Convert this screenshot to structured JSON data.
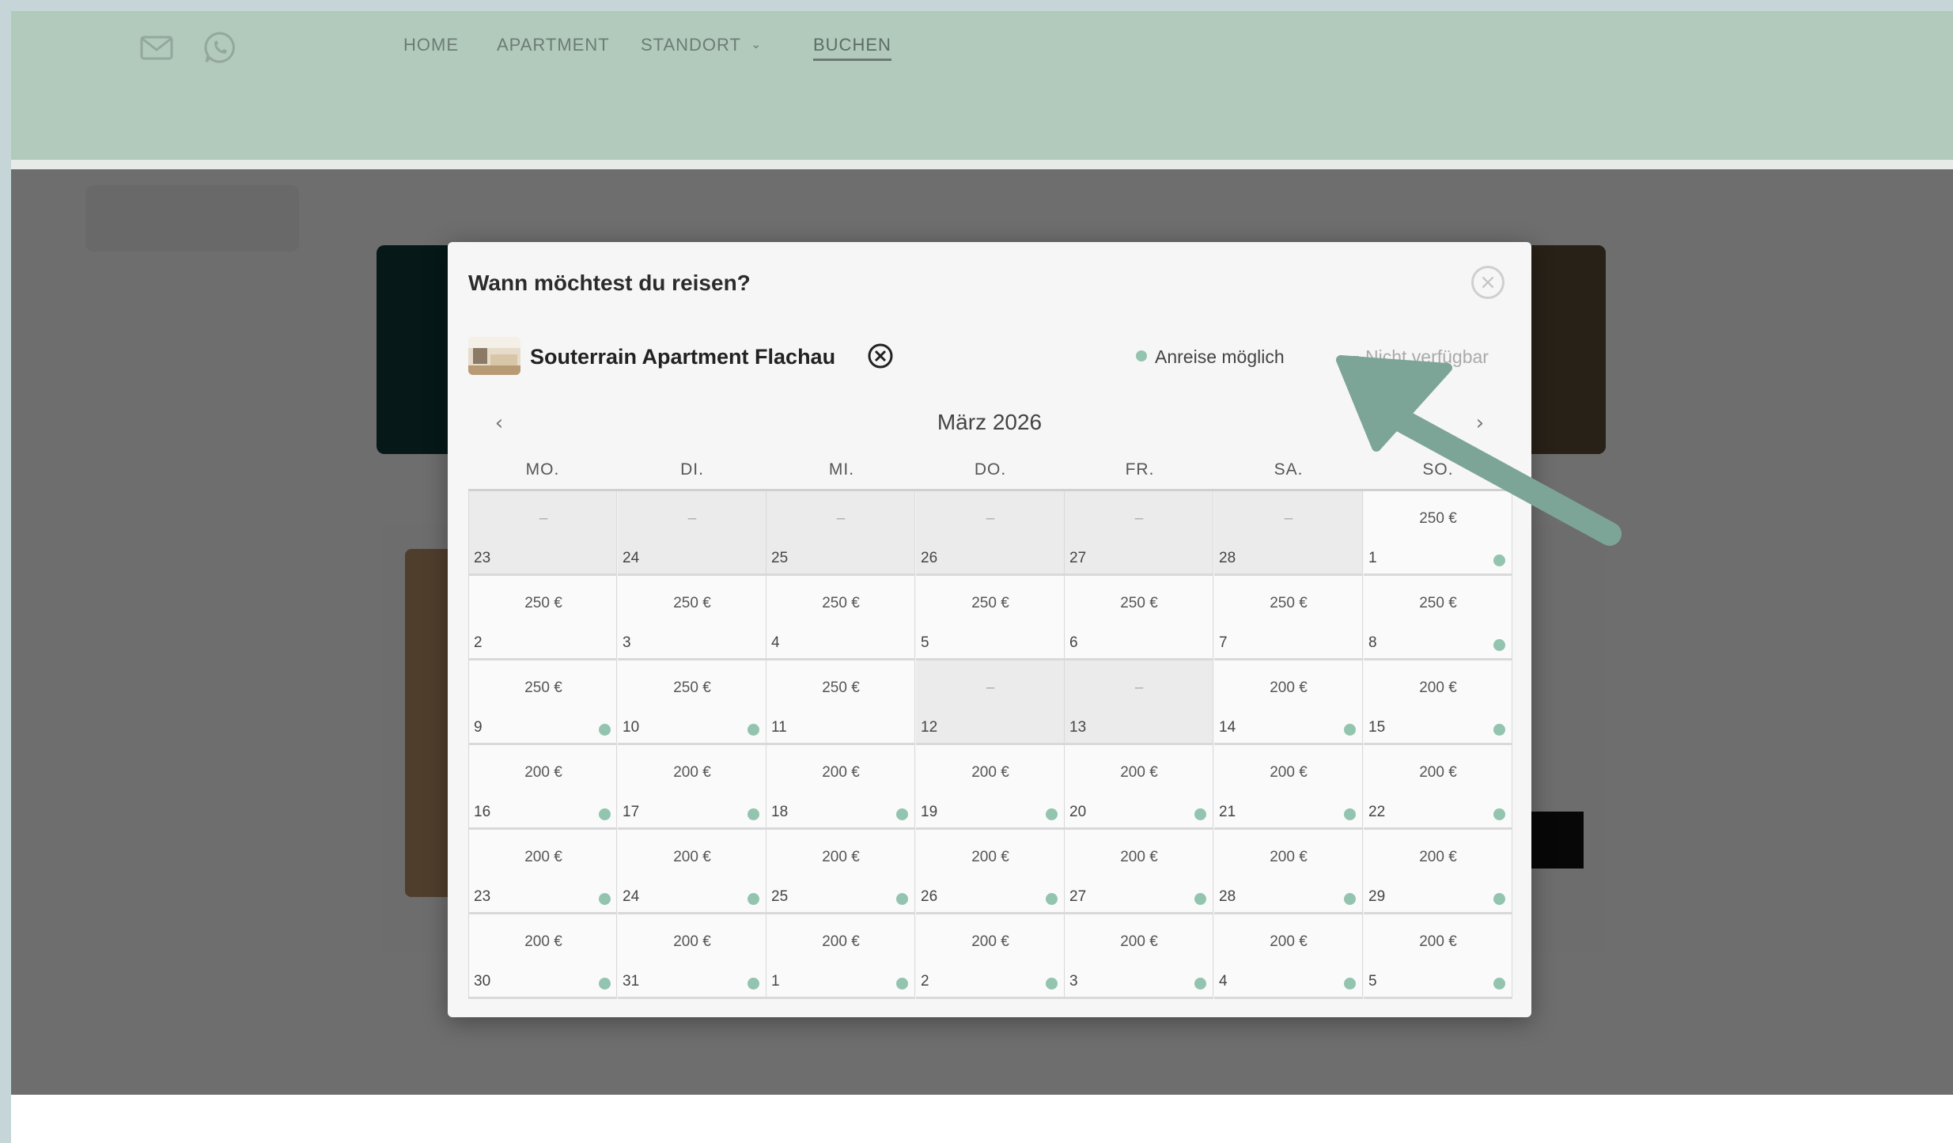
{
  "nav": {
    "items": [
      "HOME",
      "APARTMENT",
      "STANDORT",
      "BUCHEN"
    ],
    "active": "BUCHEN"
  },
  "icons": {
    "mail": "mail-icon",
    "whatsapp": "whatsapp-icon",
    "close": "close-icon",
    "remove": "remove-circle-icon"
  },
  "colors": {
    "header": "#b1cabb",
    "available_dot": "#93c4af",
    "arrow": "#7da597"
  },
  "modal": {
    "title": "Wann möchtest du reisen?",
    "close_symbol": "×",
    "apartment_name": "Souterrain Apartment Flachau",
    "legend_available": "Anreise möglich",
    "legend_unavailable": "Nicht verfügbar",
    "prev_symbol": "‹",
    "next_symbol": "›",
    "month_label": "März 2026"
  },
  "calendar": {
    "weekdays": [
      "MO.",
      "DI.",
      "MI.",
      "DO.",
      "FR.",
      "SA.",
      "SO."
    ],
    "days": [
      {
        "day": "23",
        "price": "–",
        "available": false
      },
      {
        "day": "24",
        "price": "–",
        "available": false
      },
      {
        "day": "25",
        "price": "–",
        "available": false
      },
      {
        "day": "26",
        "price": "–",
        "available": false
      },
      {
        "day": "27",
        "price": "–",
        "available": false
      },
      {
        "day": "28",
        "price": "–",
        "available": false
      },
      {
        "day": "1",
        "price": "250 €",
        "available": true
      },
      {
        "day": "2",
        "price": "250 €",
        "available": false
      },
      {
        "day": "3",
        "price": "250 €",
        "available": false
      },
      {
        "day": "4",
        "price": "250 €",
        "available": false
      },
      {
        "day": "5",
        "price": "250 €",
        "available": false
      },
      {
        "day": "6",
        "price": "250 €",
        "available": false
      },
      {
        "day": "7",
        "price": "250 €",
        "available": false
      },
      {
        "day": "8",
        "price": "250 €",
        "available": true
      },
      {
        "day": "9",
        "price": "250 €",
        "available": true
      },
      {
        "day": "10",
        "price": "250 €",
        "available": true
      },
      {
        "day": "11",
        "price": "250 €",
        "available": false
      },
      {
        "day": "12",
        "price": "–",
        "available": false
      },
      {
        "day": "13",
        "price": "–",
        "available": false
      },
      {
        "day": "14",
        "price": "200 €",
        "available": true
      },
      {
        "day": "15",
        "price": "200 €",
        "available": true
      },
      {
        "day": "16",
        "price": "200 €",
        "available": true
      },
      {
        "day": "17",
        "price": "200 €",
        "available": true
      },
      {
        "day": "18",
        "price": "200 €",
        "available": true
      },
      {
        "day": "19",
        "price": "200 €",
        "available": true
      },
      {
        "day": "20",
        "price": "200 €",
        "available": true
      },
      {
        "day": "21",
        "price": "200 €",
        "available": true
      },
      {
        "day": "22",
        "price": "200 €",
        "available": true
      },
      {
        "day": "23",
        "price": "200 €",
        "available": true
      },
      {
        "day": "24",
        "price": "200 €",
        "available": true
      },
      {
        "day": "25",
        "price": "200 €",
        "available": true
      },
      {
        "day": "26",
        "price": "200 €",
        "available": true
      },
      {
        "day": "27",
        "price": "200 €",
        "available": true
      },
      {
        "day": "28",
        "price": "200 €",
        "available": true
      },
      {
        "day": "29",
        "price": "200 €",
        "available": true
      },
      {
        "day": "30",
        "price": "200 €",
        "available": true
      },
      {
        "day": "31",
        "price": "200 €",
        "available": true
      },
      {
        "day": "1",
        "price": "200 €",
        "available": true
      },
      {
        "day": "2",
        "price": "200 €",
        "available": true
      },
      {
        "day": "3",
        "price": "200 €",
        "available": true
      },
      {
        "day": "4",
        "price": "200 €",
        "available": true
      },
      {
        "day": "5",
        "price": "200 €",
        "available": true
      }
    ],
    "disabled_cells": [
      0,
      1,
      2,
      3,
      4,
      5,
      17,
      18
    ]
  }
}
